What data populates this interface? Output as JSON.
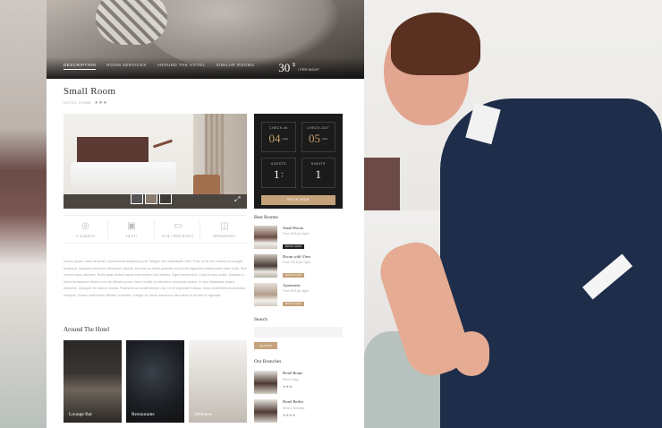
{
  "hero": {
    "tabs": [
      "DESCRIPTION",
      "ROOM SERVICES",
      "AROUND THE HOTEL",
      "SIMILAR ROOMS"
    ],
    "price_amount": "30",
    "price_currency": "$",
    "price_per": "/ PER NIGHT"
  },
  "room": {
    "title": "Small Room",
    "subtitle": "HOTEL ROME",
    "stars": "★★★"
  },
  "booking": {
    "checkin_label": "CHECK-IN",
    "checkin_day": "04",
    "checkin_month": "AUG",
    "checkout_label": "CHECK-OUT",
    "checkout_day": "05",
    "checkout_month": "AUG",
    "guests_label": "GUESTS",
    "guests_value": "1",
    "nights_label": "NIGHTS",
    "nights_value": "1",
    "book_label": "BOOK NOW"
  },
  "amenities": [
    {
      "icon": "guests-icon",
      "glyph": "◎",
      "label": "1 GUESTS"
    },
    {
      "icon": "size-icon",
      "glyph": "▣",
      "label": "15 FT²"
    },
    {
      "icon": "bed-icon",
      "glyph": "▭",
      "label": "20 $ / PER NIGHT"
    },
    {
      "icon": "breakfast-icon",
      "glyph": "◫",
      "label": "BREAKFAST"
    }
  ],
  "description": "Lorem ipsum dolor sit amet, consectetur adipiscing elit. Integer nec sollicitudin nibh. Duis ut mi nec massa id suscipit praesent. Aliquam interdum bibendum lacinia. Aenean ac tellus gravida sit conndi dignissim malesuada vitae nulla. Sed viverra nunc ultricies. Nulla quas dictum lacus sed nullam orci ultrices. Eget lacinia sed. Cras id nunc nulla. Aliquam a tortor fermentum finibus non sit dictum purus. Nunc mollis ut interdum commodo luctus. In hac habitasse platea dictumst. Quisque vel dictum lectus. Praesent at condimentum dui. Ut ut vulputate massa. Duis condimentum tincidunt volutpat. Donec sollicitudin efficitur molestie. Integer ac lacus maximus nisi luctus et ornare et egestas.",
  "around": {
    "heading": "Around The Hotel",
    "tiles": [
      "Lounge Bar",
      "Restaurants",
      "Wellness"
    ]
  },
  "sidebar": {
    "best_rooms_heading": "Best Rooms",
    "rooms": [
      {
        "name": "Small Room",
        "price": "From 30 $ per night",
        "btn": "BOOK NOW"
      },
      {
        "name": "Room with View",
        "price": "From 120 $ per night",
        "btn": "BOOK NOW"
      },
      {
        "name": "Apartment",
        "price": "From 90 $ per night",
        "btn": "BOOK NOW"
      }
    ],
    "search_heading": "Search",
    "search_placeholder": "",
    "search_btn": "SEARCH",
    "branches_heading": "Our Branches",
    "branches": [
      {
        "name": "Hotel Rome",
        "location": "Rome | Italy",
        "stars": "★★★"
      },
      {
        "name": "Hotel Berlin",
        "location": "Berlin | Germany",
        "stars": "★★★★"
      }
    ]
  },
  "colors": {
    "accent": "#c5a27b",
    "dark": "#1b1b1b"
  }
}
